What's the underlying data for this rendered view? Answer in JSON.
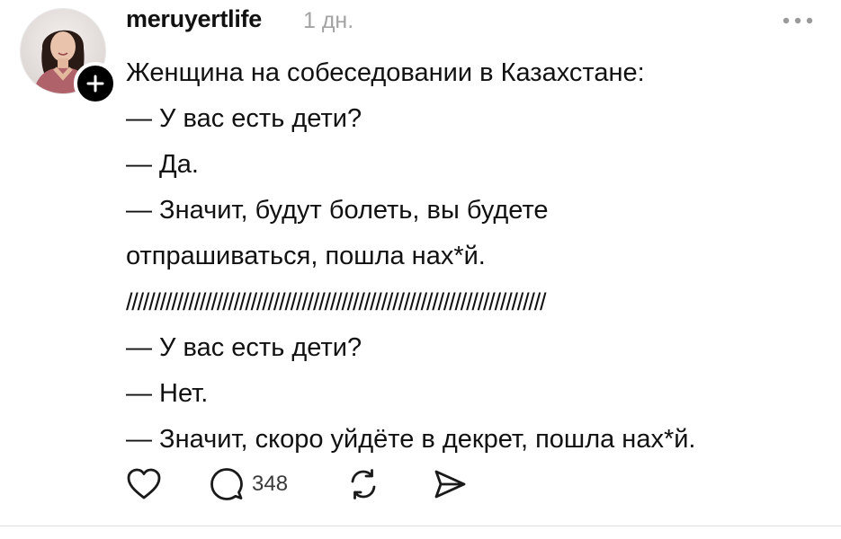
{
  "post": {
    "username": "meruyertlife",
    "timestamp": "1 дн.",
    "lines": [
      "Женщина на собеседовании в Казахстане:",
      "— У вас есть дети?",
      "— Да.",
      "— Значит, будут болеть, вы будете",
      "отпрашиваться, пошла нах*й.",
      "//////////////////////////////////////////////////////////////////////////",
      "— У вас есть дети?",
      "— Нет.",
      "— Значит, скоро уйдёте в декрет, пошла нах*й."
    ],
    "reply_count": "348"
  },
  "icons": {
    "follow": "plus-icon",
    "more": "more-horizontal-icon",
    "like": "heart-icon",
    "reply": "comment-icon",
    "repost": "repost-icon",
    "share": "send-icon"
  },
  "colors": {
    "text": "#111111",
    "muted": "#a3a3a3",
    "icon": "#1a1a1a",
    "badge": "#000000"
  }
}
